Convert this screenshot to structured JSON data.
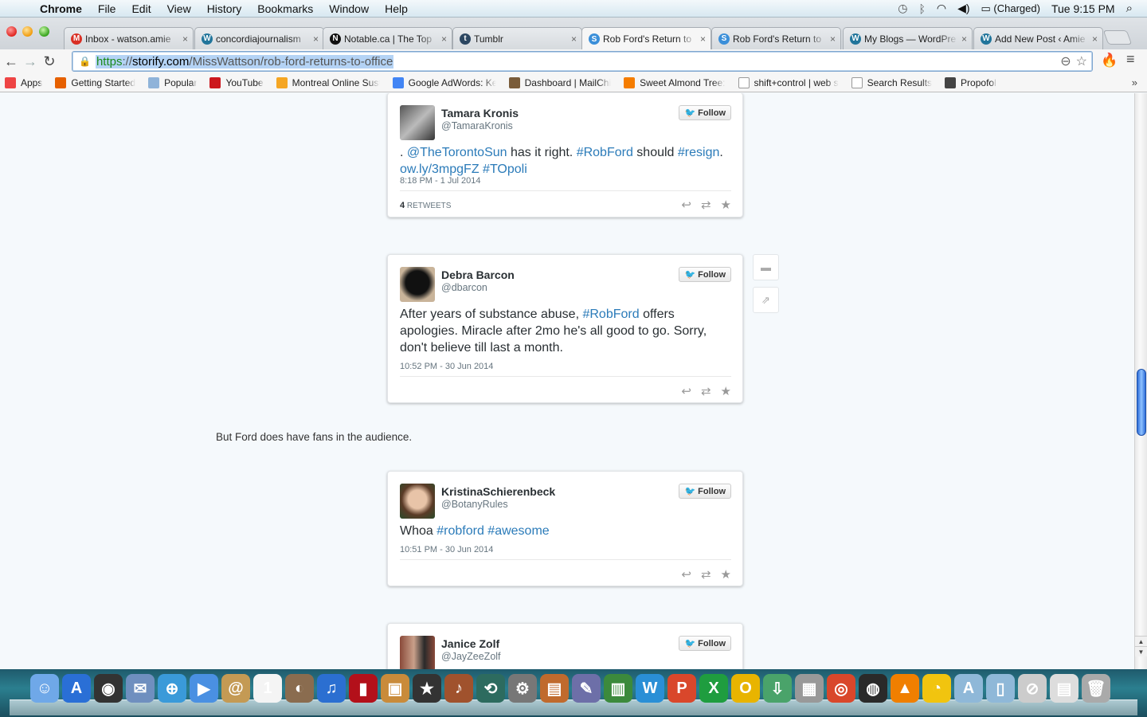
{
  "menubar": {
    "app": "Chrome",
    "items": [
      "File",
      "Edit",
      "View",
      "History",
      "Bookmarks",
      "Window",
      "Help"
    ],
    "status": {
      "battery": "(Charged)",
      "clock": "Tue 9:15 PM"
    }
  },
  "tabs": [
    {
      "title": "Inbox - watson.amie",
      "icon": "gmail-icon",
      "color": "#d93025",
      "glyph": "M"
    },
    {
      "title": "concordiajournalism",
      "icon": "wordpress-icon",
      "color": "#21759b",
      "glyph": "W"
    },
    {
      "title": "Notable.ca | The Top",
      "icon": "notable-icon",
      "color": "#111111",
      "glyph": "N"
    },
    {
      "title": "Tumblr",
      "icon": "tumblr-icon",
      "color": "#2c4762",
      "glyph": "t"
    },
    {
      "title": "Rob Ford's Return to",
      "icon": "storify-icon",
      "color": "#3b8fd9",
      "glyph": "S",
      "active": true
    },
    {
      "title": "Rob Ford's Return to",
      "icon": "storify-icon",
      "color": "#3b8fd9",
      "glyph": "S"
    },
    {
      "title": "My Blogs — WordPre",
      "icon": "wordpress-icon",
      "color": "#21759b",
      "glyph": "W"
    },
    {
      "title": "Add New Post ‹ Amie",
      "icon": "wordpress-icon",
      "color": "#21759b",
      "glyph": "W"
    }
  ],
  "omnibox": {
    "scheme": "https",
    "sep": "://",
    "host": "storify.com",
    "path": "/MissWattson/rob-ford-returns-to-office"
  },
  "bookmarks": [
    {
      "label": "Apps",
      "icon": "apps-grid-icon"
    },
    {
      "label": "Getting Started",
      "icon": "firefox-icon"
    },
    {
      "label": "Popular",
      "icon": "folder-icon"
    },
    {
      "label": "YouTube",
      "icon": "youtube-icon"
    },
    {
      "label": "Montreal Online Sust",
      "icon": "map-pin-icon"
    },
    {
      "label": "Google AdWords: Ke",
      "icon": "google-icon"
    },
    {
      "label": "Dashboard | MailChi",
      "icon": "mailchimp-icon"
    },
    {
      "label": "Sweet Almond Tree:",
      "icon": "blogger-icon"
    },
    {
      "label": "shift+control | web s",
      "icon": "page-icon"
    },
    {
      "label": "Search Results",
      "icon": "page-icon"
    },
    {
      "label": "Propofol",
      "icon": "image-icon"
    }
  ],
  "bookmarks_more": "»",
  "story": {
    "paragraph": "But Ford does have fans in the audience.",
    "follow_label": "Follow",
    "tweets": [
      {
        "name": "Tamara Kronis",
        "handle": "@TamaraKronis",
        "segments": [
          {
            "t": ". "
          },
          {
            "t": "@TheTorontoSun",
            "link": true
          },
          {
            "t": " has it right. "
          },
          {
            "t": "#RobFord",
            "link": true
          },
          {
            "t": " should "
          },
          {
            "t": "#resign",
            "link": true
          },
          {
            "t": ". "
          },
          {
            "t": "ow.ly/3mpgFZ",
            "link": true
          },
          {
            "t": " "
          },
          {
            "t": "#TOpoli",
            "link": true
          }
        ],
        "time": "8:18 PM - 1 Jul 2014",
        "retweets_count": "4",
        "retweets_label": "RETWEETS"
      },
      {
        "name": "Debra Barcon",
        "handle": "@dbarcon",
        "segments": [
          {
            "t": "After years of substance abuse, "
          },
          {
            "t": "#RobFord",
            "link": true
          },
          {
            "t": " offers apologies. Miracle after 2mo he's all good to go. Sorry, don't believe till last a month."
          }
        ],
        "time": "10:52 PM - 30 Jun 2014"
      },
      {
        "name": "KristinaSchierenbeck",
        "handle": "@BotanyRules",
        "segments": [
          {
            "t": "Whoa "
          },
          {
            "t": "#robford",
            "link": true
          },
          {
            "t": " "
          },
          {
            "t": "#awesome",
            "link": true
          }
        ],
        "time": "10:51 PM - 30 Jun 2014"
      },
      {
        "name": "Janice Zolf",
        "handle": "@JayZeeZolf"
      }
    ]
  },
  "dock": [
    {
      "name": "finder",
      "color": "#6fa8e8",
      "glyph": "☺"
    },
    {
      "name": "app-store",
      "color": "#2a6fd6",
      "glyph": "A"
    },
    {
      "name": "dashboard",
      "color": "#333333",
      "glyph": "◉"
    },
    {
      "name": "mail",
      "color": "#6f8fbf",
      "glyph": "✉"
    },
    {
      "name": "safari",
      "color": "#3a9ad9",
      "glyph": "⊕"
    },
    {
      "name": "facetime",
      "color": "#4a90e2",
      "glyph": "▶"
    },
    {
      "name": "contacts",
      "color": "#c49a54",
      "glyph": "@"
    },
    {
      "name": "calendar",
      "color": "#f4f4f4",
      "glyph": "1"
    },
    {
      "name": "photo-booth",
      "color": "#8a6c4f",
      "glyph": "◐"
    },
    {
      "name": "itunes",
      "color": "#2b6fd1",
      "glyph": "♫"
    },
    {
      "name": "photo-booth-2",
      "color": "#b3101a",
      "glyph": "▮"
    },
    {
      "name": "iphoto",
      "color": "#c98b3a",
      "glyph": "▣"
    },
    {
      "name": "imovie",
      "color": "#333333",
      "glyph": "★"
    },
    {
      "name": "garageband",
      "color": "#a0522d",
      "glyph": "♪"
    },
    {
      "name": "time-machine",
      "color": "#2d6b5f",
      "glyph": "⟲"
    },
    {
      "name": "system-preferences",
      "color": "#777777",
      "glyph": "⚙"
    },
    {
      "name": "keynote",
      "color": "#c06a2d",
      "glyph": "▤"
    },
    {
      "name": "script-editor",
      "color": "#6d6fa8",
      "glyph": "✎"
    },
    {
      "name": "numbers",
      "color": "#3c8a3c",
      "glyph": "▥"
    },
    {
      "name": "word",
      "color": "#2a8fd6",
      "glyph": "W"
    },
    {
      "name": "powerpoint",
      "color": "#d9472b",
      "glyph": "P"
    },
    {
      "name": "excel",
      "color": "#1f9d3f",
      "glyph": "X"
    },
    {
      "name": "outlook",
      "color": "#e8b400",
      "glyph": "O"
    },
    {
      "name": "transmission",
      "color": "#4aa36a",
      "glyph": "⇩"
    },
    {
      "name": "printer",
      "color": "#999999",
      "glyph": "▦"
    },
    {
      "name": "chrome",
      "color": "#d9472b",
      "glyph": "◎"
    },
    {
      "name": "logic",
      "color": "#2a2a2a",
      "glyph": "◍"
    },
    {
      "name": "vlc",
      "color": "#f07f00",
      "glyph": "▲"
    },
    {
      "name": "cyberduck",
      "color": "#f1c40f",
      "glyph": "◔"
    },
    {
      "name": "applications-folder",
      "color": "#8fb8d8",
      "glyph": "A"
    },
    {
      "name": "documents-folder",
      "color": "#8fb8d8",
      "glyph": "▯"
    },
    {
      "name": "downloads-stack",
      "color": "#cccccc",
      "glyph": "⊘"
    },
    {
      "name": "screenshot-stack",
      "color": "#dddddd",
      "glyph": "▤"
    },
    {
      "name": "trash",
      "color": "#aaaaaa",
      "glyph": "🗑"
    }
  ]
}
